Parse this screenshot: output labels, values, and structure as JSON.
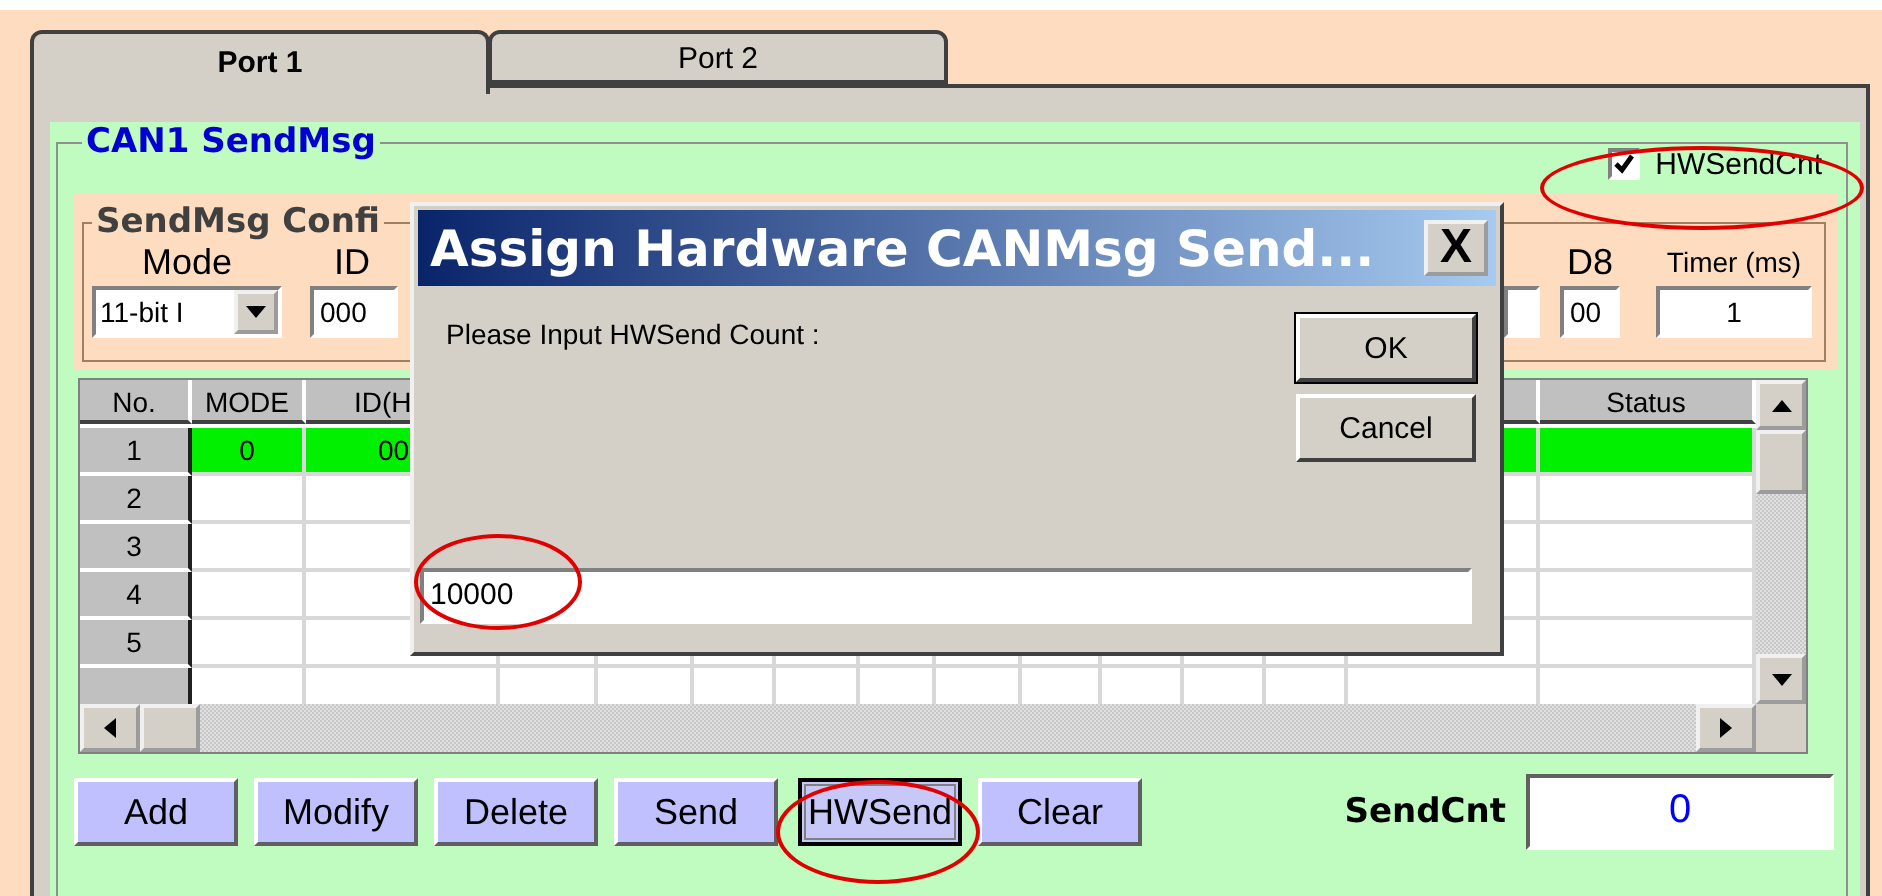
{
  "tabs": [
    {
      "label": "Port 1",
      "selected": true
    },
    {
      "label": "Port 2",
      "selected": false
    }
  ],
  "send_group": {
    "title": "CAN1 SendMsg",
    "hw_send_cnt": {
      "label": "HWSendCnt",
      "checked": true,
      "highlighted": true
    }
  },
  "config": {
    "title": "SendMsg Confi",
    "mode": {
      "label": "Mode",
      "value": "11-bit I"
    },
    "id": {
      "label": "ID",
      "value": "000"
    },
    "d8": {
      "label": "D8",
      "value": "00"
    },
    "timer": {
      "label": "Timer (ms)",
      "value": "1"
    }
  },
  "table": {
    "columns": [
      {
        "label": "No."
      },
      {
        "label": "MODE"
      },
      {
        "label": "ID(H"
      },
      {
        "label": "Status"
      }
    ],
    "rows": [
      {
        "no": "1",
        "mode": "0",
        "id": "00",
        "selected": true
      },
      {
        "no": "2",
        "selected": false
      },
      {
        "no": "3",
        "selected": false
      },
      {
        "no": "4",
        "selected": false
      },
      {
        "no": "5",
        "selected": false
      },
      {
        "selected": false
      }
    ]
  },
  "buttons": [
    {
      "label": "Add",
      "focused": false,
      "highlighted": false
    },
    {
      "label": "Modify",
      "focused": false,
      "highlighted": false
    },
    {
      "label": "Delete",
      "focused": false,
      "highlighted": false
    },
    {
      "label": "Send",
      "focused": false,
      "highlighted": false
    },
    {
      "label": "HWSend",
      "focused": true,
      "highlighted": true
    },
    {
      "label": "Clear",
      "focused": false,
      "highlighted": false
    }
  ],
  "send_cnt": {
    "label": "SendCnt",
    "value": "0"
  },
  "dialog": {
    "title": "Assign Hardware CANMsg Send...",
    "close": "X",
    "prompt": "Please Input HWSend Count :",
    "ok": "OK",
    "cancel": "Cancel",
    "input": {
      "value": "10000",
      "highlighted": true
    }
  }
}
